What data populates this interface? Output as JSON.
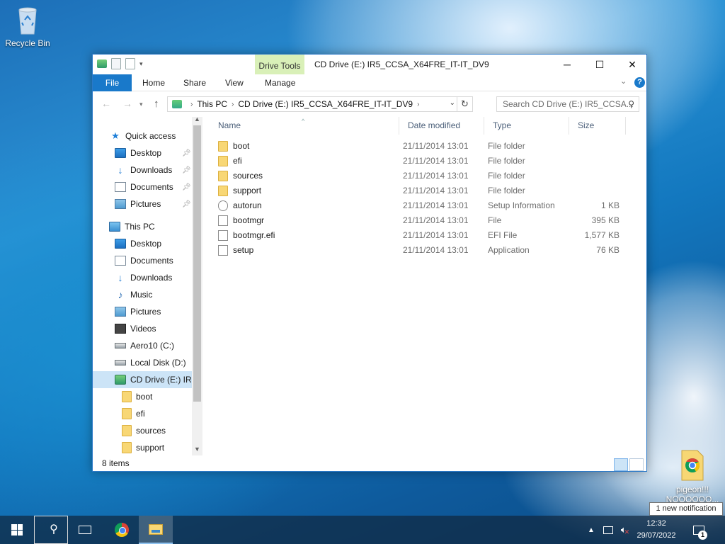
{
  "desktop": {
    "recycle_bin_label": "Recycle Bin",
    "pigeon_label": "pigeon!!! NOOOOOO..."
  },
  "window": {
    "title": "CD Drive (E:) IR5_CCSA_X64FRE_IT-IT_DV9",
    "context_tab": "Drive Tools",
    "ribbon_tabs": [
      "File",
      "Home",
      "Share",
      "View",
      "Manage"
    ],
    "controls": {
      "minimize": "─",
      "maximize": "☐",
      "close": "✕"
    }
  },
  "address_bar": {
    "segments": [
      "This PC",
      "CD Drive (E:) IR5_CCSA_X64FRE_IT-IT_DV9"
    ],
    "search_placeholder": "Search CD Drive (E:) IR5_CCSA..."
  },
  "nav_pane": {
    "quick_access": "Quick access",
    "quick_items": [
      "Desktop",
      "Downloads",
      "Documents",
      "Pictures"
    ],
    "this_pc": "This PC",
    "pc_items": [
      "Desktop",
      "Documents",
      "Downloads",
      "Music",
      "Pictures",
      "Videos",
      "Aero10 (C:)",
      "Local Disk (D:)",
      "CD Drive (E:) IR5_"
    ],
    "drive_children": [
      "boot",
      "efi",
      "sources",
      "support"
    ]
  },
  "columns": {
    "name": "Name",
    "date": "Date modified",
    "type": "Type",
    "size": "Size"
  },
  "files": [
    {
      "name": "boot",
      "date": "21/11/2014 13:01",
      "type": "File folder",
      "size": "",
      "icon": "folder"
    },
    {
      "name": "efi",
      "date": "21/11/2014 13:01",
      "type": "File folder",
      "size": "",
      "icon": "folder"
    },
    {
      "name": "sources",
      "date": "21/11/2014 13:01",
      "type": "File folder",
      "size": "",
      "icon": "folder"
    },
    {
      "name": "support",
      "date": "21/11/2014 13:01",
      "type": "File folder",
      "size": "",
      "icon": "folder"
    },
    {
      "name": "autorun",
      "date": "21/11/2014 13:01",
      "type": "Setup Information",
      "size": "1 KB",
      "icon": "gear"
    },
    {
      "name": "bootmgr",
      "date": "21/11/2014 13:01",
      "type": "File",
      "size": "395 KB",
      "icon": "file"
    },
    {
      "name": "bootmgr.efi",
      "date": "21/11/2014 13:01",
      "type": "EFI File",
      "size": "1,577 KB",
      "icon": "file"
    },
    {
      "name": "setup",
      "date": "21/11/2014 13:01",
      "type": "Application",
      "size": "76 KB",
      "icon": "file"
    }
  ],
  "status": {
    "item_count": "8 items"
  },
  "notification": {
    "tooltip": "1 new notification",
    "count": "1"
  },
  "taskbar": {
    "time": "12:32",
    "date": "29/07/2022"
  }
}
